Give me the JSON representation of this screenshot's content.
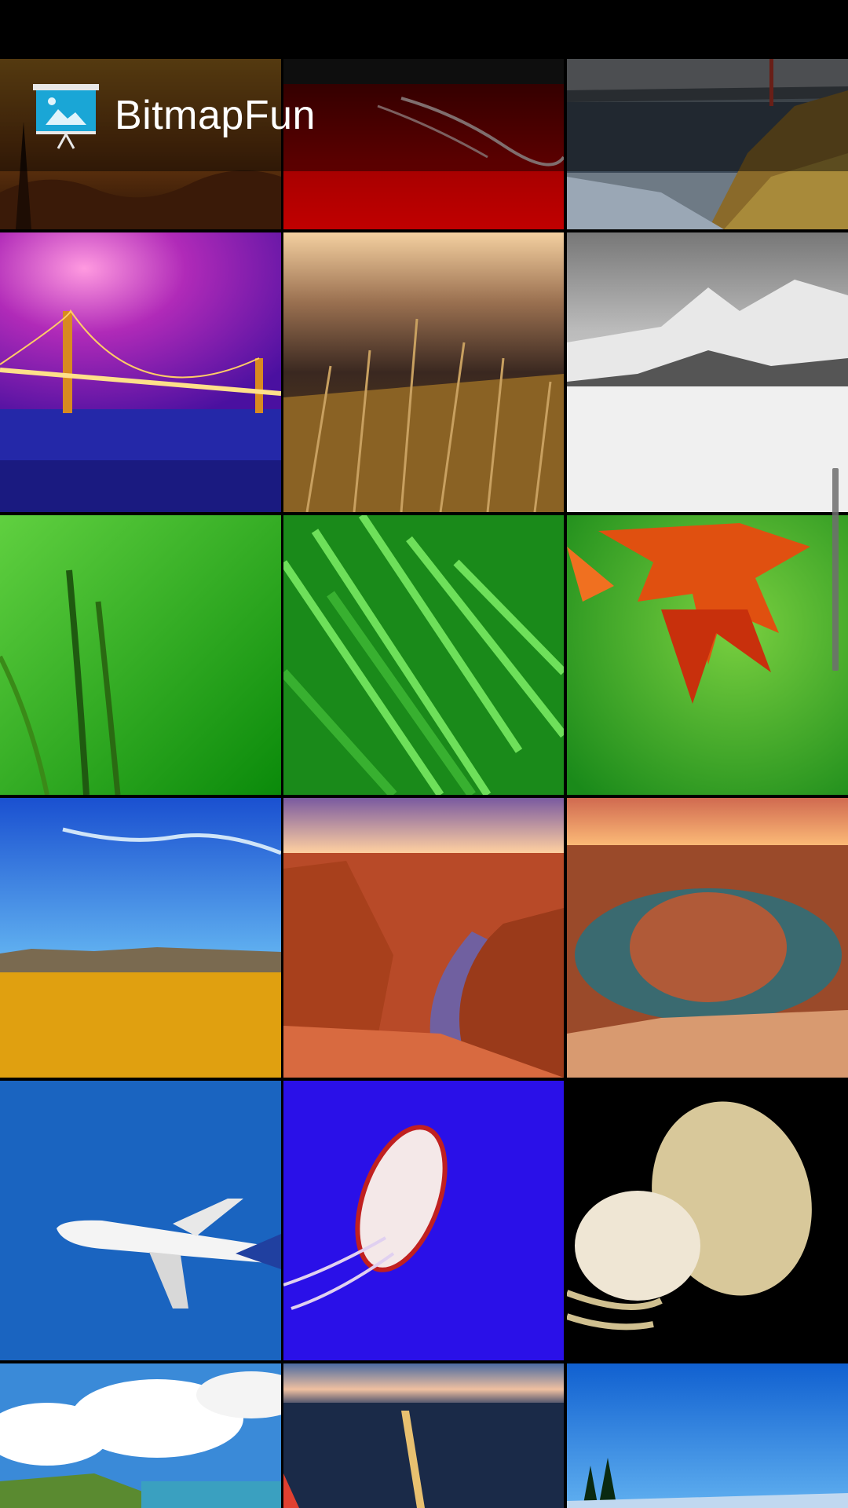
{
  "app": {
    "title": "BitmapFun",
    "icon": "slideshow-icon"
  },
  "grid": {
    "columns": 3,
    "images": [
      {
        "subject": "autumn-forest"
      },
      {
        "subject": "red-car-hood"
      },
      {
        "subject": "coastline-golden-gate"
      },
      {
        "subject": "golden-gate-purple-night"
      },
      {
        "subject": "dry-grass-sunset"
      },
      {
        "subject": "snowy-mountains-bw"
      },
      {
        "subject": "green-grass-blades"
      },
      {
        "subject": "green-grass-closeup"
      },
      {
        "subject": "red-maple-leaf"
      },
      {
        "subject": "desert-plain-blue-sky"
      },
      {
        "subject": "red-canyon-river"
      },
      {
        "subject": "horseshoe-bend"
      },
      {
        "subject": "airbus-a380"
      },
      {
        "subject": "jellyfish-blue"
      },
      {
        "subject": "jellyfish-black"
      },
      {
        "subject": "clouds-coast"
      },
      {
        "subject": "city-dusk"
      },
      {
        "subject": "blue-sky-trees"
      }
    ]
  },
  "scrollbar": {
    "position": 0.28
  }
}
